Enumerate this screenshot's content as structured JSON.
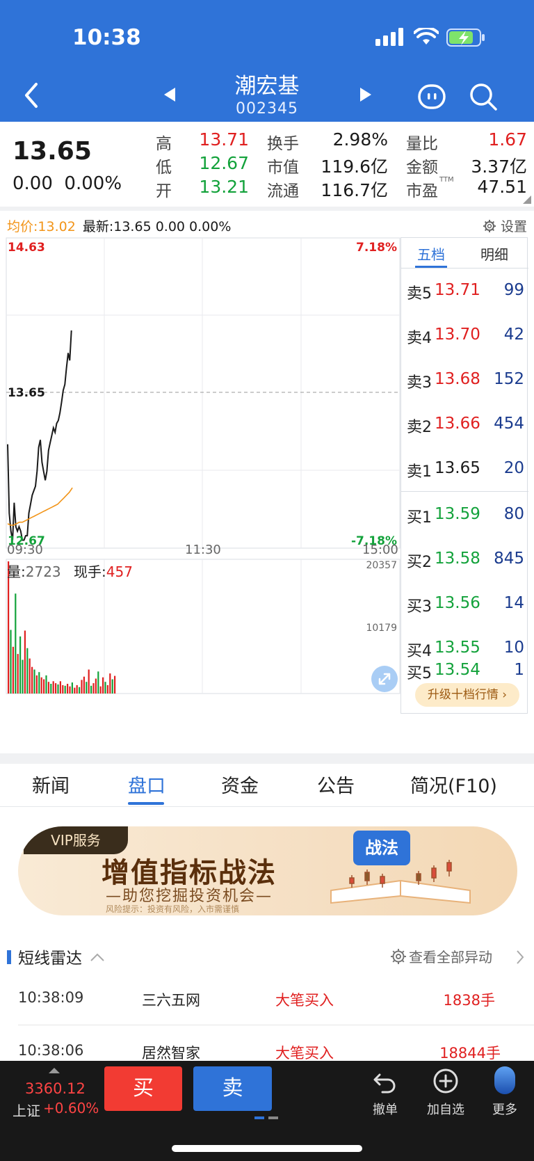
{
  "status_bar": {
    "time": "10:38"
  },
  "nav": {
    "title": "潮宏基",
    "code": "002345"
  },
  "quote": {
    "price": "13.65",
    "change": "0.00",
    "change_pct": "0.00%",
    "stats": [
      {
        "label": "高",
        "value": "13.71",
        "color": "#e02020"
      },
      {
        "label": "换手",
        "value": "2.98%",
        "color": "#1a1a1a"
      },
      {
        "label": "量比",
        "value": "1.67",
        "color": "#e02020"
      },
      {
        "label": "低",
        "value": "12.67",
        "color": "#13a23b"
      },
      {
        "label": "市值",
        "value": "119.6亿",
        "color": "#1a1a1a"
      },
      {
        "label": "金额",
        "value": "3.37亿",
        "color": "#1a1a1a"
      },
      {
        "label": "开",
        "value": "13.21",
        "color": "#13a23b"
      },
      {
        "label": "流通",
        "value": "116.7亿",
        "color": "#1a1a1a"
      },
      {
        "label": "市盈",
        "value": "47.51",
        "color": "#1a1a1a"
      }
    ],
    "pe_suffix": "TTM"
  },
  "chart_info": {
    "avg_label": "均价:13.02",
    "latest_label": "最新:13.65",
    "latest_change": "0.00",
    "latest_pct": "0.00%",
    "settings_label": "设置"
  },
  "chart_data": {
    "type": "line",
    "title": "",
    "price_axis": {
      "max_label": "14.63",
      "min_label": "12.67",
      "max_pct": "7.18%",
      "min_pct": "-7.18%",
      "current_label": "13.65",
      "ylim": [
        12.67,
        14.63
      ]
    },
    "time_axis": {
      "labels": [
        "09:30",
        "11:30",
        "15:00"
      ]
    },
    "series": [
      {
        "values": [
          13.34,
          12.88,
          12.76,
          12.7,
          12.95,
          12.79,
          12.76,
          12.79,
          12.76,
          12.7,
          12.7,
          12.73,
          12.73,
          12.88,
          12.94,
          13.0,
          13.03,
          13.06,
          13.16,
          13.32,
          13.37,
          13.22,
          13.16,
          13.1,
          13.16,
          13.3,
          13.35,
          13.4,
          13.45,
          13.42,
          13.48,
          13.5,
          13.55,
          13.62,
          13.7,
          13.74,
          13.85,
          13.95,
          13.9,
          14.1
        ]
      },
      {
        "values": [
          12.81,
          12.8,
          12.8,
          12.81,
          12.82,
          12.82,
          12.83,
          12.84,
          12.85,
          12.86,
          12.87,
          12.88,
          12.89,
          12.9,
          12.91,
          12.92,
          12.93,
          12.94,
          12.96,
          12.98,
          13.0,
          13.02,
          13.05
        ]
      }
    ],
    "volume": {
      "label": "量:",
      "value": "2723",
      "hand_label": "现手:",
      "hand_value": "457",
      "max_label": "20357",
      "mid_label": "10179",
      "ylim": [
        0,
        20357
      ],
      "values": [
        20357,
        9800,
        7200,
        15400,
        6100,
        8800,
        5200,
        9700,
        7000,
        5400,
        4100,
        3700,
        2800,
        3300,
        2500,
        2200,
        2800,
        1800,
        1500,
        1900,
        1600,
        1400,
        1900,
        1300,
        1200,
        1500,
        1100,
        1700,
        900,
        1300,
        1000,
        2100,
        2600,
        1800,
        3700,
        1200,
        1600,
        2300,
        3400,
        1100,
        2500,
        1800,
        1300,
        3100,
        2200,
        2723
      ],
      "colors": [
        "red",
        "green",
        "red",
        "green",
        "red",
        "green",
        "green",
        "red",
        "green",
        "red",
        "red",
        "green",
        "red",
        "green",
        "red",
        "red",
        "green",
        "red",
        "green",
        "red",
        "red",
        "green",
        "red",
        "red",
        "green",
        "red",
        "red",
        "green",
        "red",
        "red",
        "green",
        "red",
        "red",
        "green",
        "red",
        "green",
        "red",
        "red",
        "green",
        "red",
        "red",
        "green",
        "red",
        "red",
        "green",
        "red"
      ]
    }
  },
  "order_book": {
    "tabs": [
      "五档",
      "明细"
    ],
    "asks": [
      {
        "label": "卖5",
        "price": "13.71",
        "vol": "99",
        "color": "#e02020"
      },
      {
        "label": "卖4",
        "price": "13.70",
        "vol": "42",
        "color": "#e02020"
      },
      {
        "label": "卖3",
        "price": "13.68",
        "vol": "152",
        "color": "#e02020"
      },
      {
        "label": "卖2",
        "price": "13.66",
        "vol": "454",
        "color": "#e02020"
      },
      {
        "label": "卖1",
        "price": "13.65",
        "vol": "20",
        "color": "#1a1a1a"
      }
    ],
    "bids": [
      {
        "label": "买1",
        "price": "13.59",
        "vol": "80",
        "color": "#13a23b"
      },
      {
        "label": "买2",
        "price": "13.58",
        "vol": "845",
        "color": "#13a23b"
      },
      {
        "label": "买3",
        "price": "13.56",
        "vol": "14",
        "color": "#13a23b"
      },
      {
        "label": "买4",
        "price": "13.55",
        "vol": "10",
        "color": "#13a23b"
      },
      {
        "label": "买5",
        "price": "13.54",
        "vol": "1",
        "color": "#13a23b"
      }
    ],
    "upgrade": "升级十档行情"
  },
  "tabs": [
    "新闻",
    "盘口",
    "资金",
    "公告",
    "简况(F10)"
  ],
  "banner": {
    "vip": "VIP服务",
    "title": "增值指标战法",
    "subtitle": "—助您挖掘投资机会—",
    "risk": "风险提示：投资有风险，入市需谨慎",
    "badge": "战法"
  },
  "radar": {
    "title": "短线雷达",
    "more": "查看全部异动",
    "rows": [
      {
        "time": "10:38:09",
        "name": "三六五网",
        "action": "大笔买入",
        "qty": "1838手"
      },
      {
        "time": "10:38:06",
        "name": "居然智家",
        "action": "大笔买入",
        "qty": "18844手"
      }
    ]
  },
  "bottom": {
    "index_value": "3360.12",
    "index_name": "上证",
    "index_pct": "+0.60%",
    "buy": "买",
    "sell": "卖",
    "cancel": "撤单",
    "add_fav": "加自选",
    "more": "更多"
  }
}
